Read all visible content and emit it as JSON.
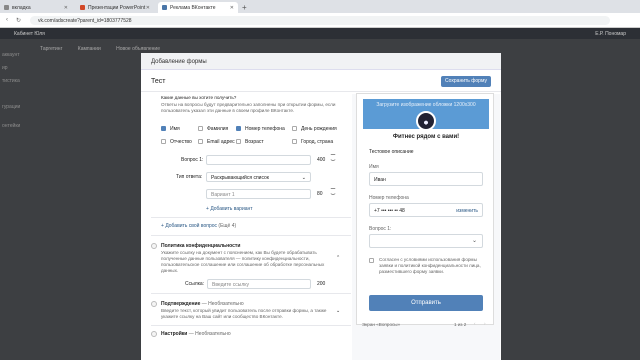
{
  "browser": {
    "tabs": [
      {
        "label": "вкладка"
      },
      {
        "label": "Презентации PowerPoint"
      },
      {
        "label": "Реклама ВКонтакте"
      }
    ],
    "url": "vk.com/adscreate?parent_id=1803777528"
  },
  "vk_header": {
    "left": "Кабинет Юля",
    "right": "Е.Р. Пономар"
  },
  "sidebar": [
    "аккаунт",
    "ир",
    "тистика",
    "",
    "гурации",
    "",
    "",
    "онтейки"
  ],
  "subnav": [
    "Таргетинг",
    "Кампании",
    "Новое объявление"
  ],
  "modal": {
    "title": "Добавление формы",
    "form_name": "Тест",
    "save_label": "Сохранить форму",
    "question_prompt": "Какие данные вы хотите получить?",
    "question_hint": "Ответы на вопросы будут предварительно заполнены при открытии формы, если пользователь указал эти данные в своем профиле ВКонтакте.",
    "fields": [
      {
        "label": "Имя",
        "checked": true
      },
      {
        "label": "Фамилия",
        "checked": false
      },
      {
        "label": "Номер телефона",
        "checked": true
      },
      {
        "label": "День рождения",
        "checked": false
      },
      {
        "label": "Отчество",
        "checked": false
      },
      {
        "label": "Email адрес",
        "checked": false
      },
      {
        "label": "Возраст",
        "checked": false
      },
      {
        "label": "Город, страна",
        "checked": false
      }
    ],
    "question1_label": "Вопрос 1:",
    "question1_count": "400",
    "answer_type_label": "Тип ответа:",
    "answer_type_value": "Раскрывающийся список",
    "variant1_placeholder": "Вариант 1",
    "variant1_count": "80",
    "add_variant": "Добавить вариант",
    "add_question": "Добавить свой вопрос",
    "add_question_count": "(Ещё 4)",
    "privacy_title": "Политика конфиденциальности",
    "privacy_text": "Укажите ссылку на документ с пояснением, как Вы будете обрабатывать полученные данные пользователя — политику конфиденциальности, пользовательское соглашение или соглашение об обработке персональных данных.",
    "link_label": "Ссылка:",
    "link_placeholder": "Введите ссылку",
    "link_count": "200",
    "confirm_title": "Подтверждение",
    "confirm_optional": "Необязательно",
    "confirm_text": "Введите текст, который увидит пользователь после отправки формы, а также укажите ссылку на Ваш сайт или сообщество ВКонтакте.",
    "settings_title": "Настройки",
    "settings_optional": "Необязательно"
  },
  "preview": {
    "banner_text": "Загрузите изображение обложки 1200x300",
    "title": "Фитнес рядом с вами!",
    "description": "Тестовое описание",
    "name_label": "Имя",
    "name_value": "Иван",
    "phone_label": "Номер телефона",
    "phone_value": "+7 ••• ••• •• 48",
    "phone_change": "изменить",
    "question_label": "Вопрос 1:",
    "consent": "Согласен с условиями использования формы заявки и политикой конфиденциальности лица, разместившего форму заявки.",
    "send_label": "Отправить",
    "footer_screen": "Экран «Вопросы»",
    "footer_pages": "1 из 2"
  }
}
